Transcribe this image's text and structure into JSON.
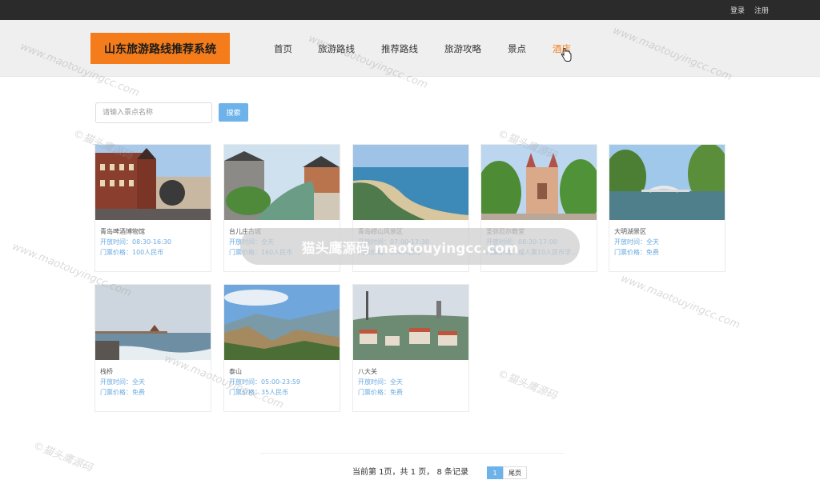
{
  "topbar": {
    "login": "登录",
    "register": "注册"
  },
  "logo": {
    "text": "山东旅游路线推荐系统"
  },
  "nav": {
    "items": [
      {
        "label": "首页"
      },
      {
        "label": "旅游路线"
      },
      {
        "label": "推荐路线"
      },
      {
        "label": "旅游攻略"
      },
      {
        "label": "景点"
      },
      {
        "label": "酒店"
      }
    ],
    "active_index": 5
  },
  "search": {
    "placeholder": "请输入景点名称",
    "button_label": "搜索"
  },
  "attractions": [
    {
      "name": "青岛啤酒博物馆",
      "hours": "开放时间：08:30-16:30",
      "price": "门票价格：100人民币"
    },
    {
      "name": "台儿庄古城",
      "hours": "开放时间：全天",
      "price": "门票价格：160人民币"
    },
    {
      "name": "青岛崂山风景区",
      "hours": "开放时间：07:00-17:30",
      "price": "门票价格：130人民币"
    },
    {
      "name": "圣弥厄尔教堂",
      "hours": "开放时间：08:30-17:00",
      "price": "门票价格：成人票10人民币学..."
    },
    {
      "name": "大明湖景区",
      "hours": "开放时间：全天",
      "price": "门票价格：免费"
    },
    {
      "name": "栈桥",
      "hours": "开放时间：全天",
      "price": "门票价格：免费"
    },
    {
      "name": "泰山",
      "hours": "开放时间：05:00-23:59",
      "price": "门票价格：35人民币"
    },
    {
      "name": "八大关",
      "hours": "开放时间：全天",
      "price": "门票价格：免费"
    }
  ],
  "pagination": {
    "summary": "当前第 1页，共 1 页， 8 条记录",
    "current_page": "1",
    "last_label": "尾页"
  },
  "watermark": {
    "site": "www.maotouyingcc.com",
    "brand": "©猫头鹰源码",
    "pill_text": "猫头鹰源码 maotouyingcc.com"
  },
  "colors": {
    "accent": "#f47c1a",
    "link": "#6aa9e0",
    "button": "#6db3ea",
    "topbar": "#2b2b2b"
  }
}
